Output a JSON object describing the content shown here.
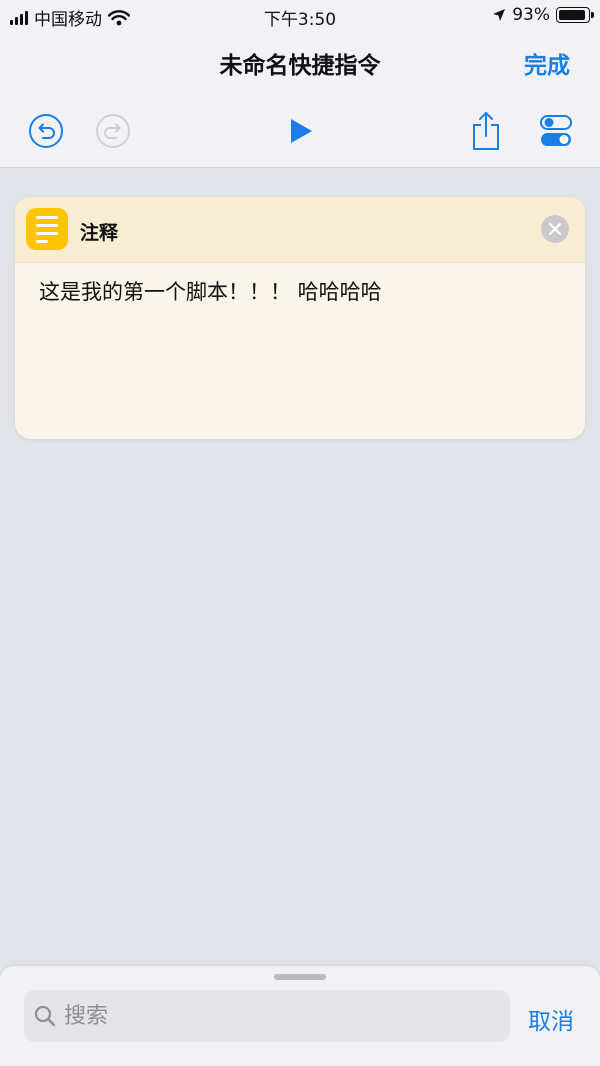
{
  "status_bar": {
    "carrier": "中国移动",
    "time": "下午3:50",
    "battery_percent": "93%",
    "battery_level": 0.93
  },
  "navbar": {
    "title": "未命名快捷指令",
    "done_label": "完成"
  },
  "toolbar": {
    "icons": [
      "undo-icon",
      "redo-icon",
      "play-icon",
      "share-icon",
      "settings-toggle-icon"
    ]
  },
  "comment_card": {
    "title": "注释",
    "text": "这是我的第一个脚本！！！ 哈哈哈哈"
  },
  "search_sheet": {
    "placeholder": "搜索",
    "cancel_label": "取消"
  },
  "colors": {
    "accent": "#1a7ee6",
    "comment_icon": "#ffc400",
    "card_bg": "#faf5ea",
    "card_header": "#f8edd3"
  }
}
